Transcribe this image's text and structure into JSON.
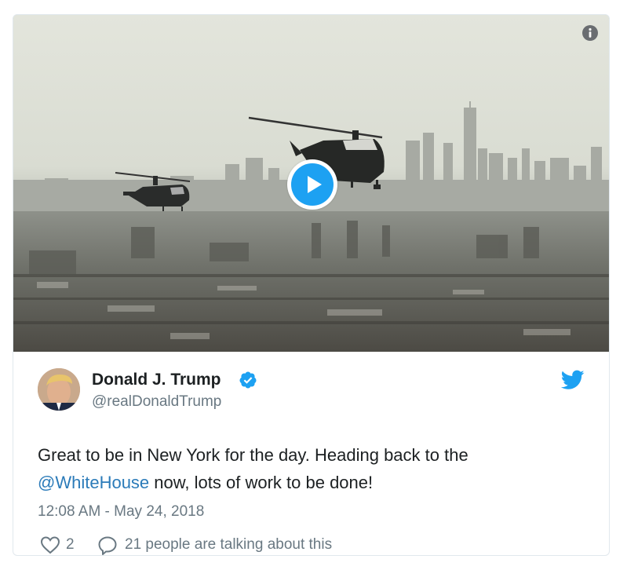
{
  "media": {
    "info_icon": "info-icon",
    "play_icon": "play-icon",
    "accent_color": "#1da1f2"
  },
  "author": {
    "name": "Donald J. Trump",
    "handle": "@realDonaldTrump",
    "verified_icon": "verified-badge-icon"
  },
  "brand_icon": "twitter-bird-icon",
  "tweet": {
    "text_before": "Great to be in New York for the day. Heading back to the",
    "mention": "@WhiteHouse",
    "text_after": " now, lots of work to be done!",
    "timestamp": "12:08 AM - May 24, 2018"
  },
  "actions": {
    "like_count": "2",
    "reply_label": "21 people are talking about this"
  },
  "colors": {
    "text": "#1c2022",
    "secondary": "#697882",
    "link": "#2b7bb9"
  }
}
